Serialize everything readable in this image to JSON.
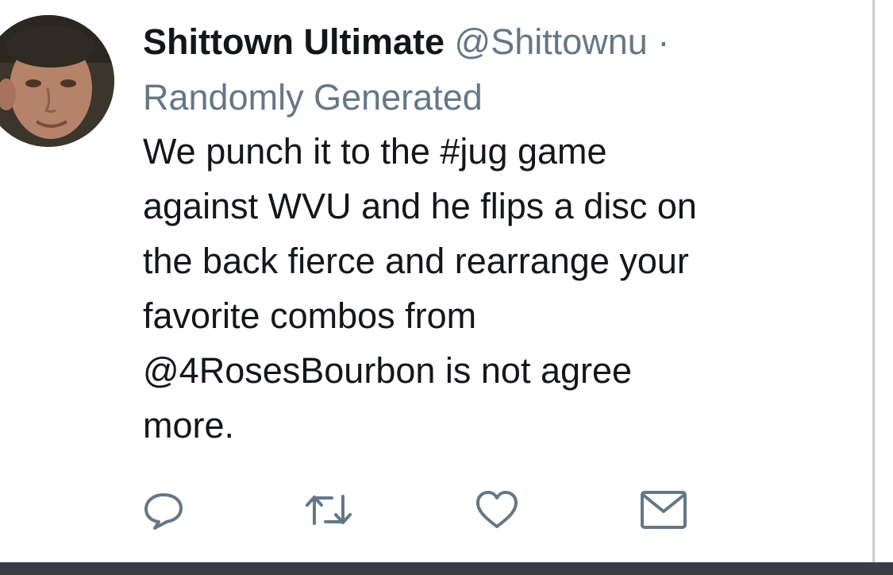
{
  "tweet": {
    "display_name": "Shittown Ultimate",
    "handle": "@Shittownu",
    "separator": "·",
    "subline": "Randomly Generated",
    "body_lines": [
      "We punch it to the #jug game",
      "against WVU and he flips a disc on",
      "the back fierce and rearrange your",
      "favorite combos from",
      "@4RosesBourbon is not agree",
      "more."
    ]
  },
  "actions": [
    {
      "icon": "reply-icon"
    },
    {
      "icon": "retweet-icon"
    },
    {
      "icon": "like-icon"
    },
    {
      "icon": "direct-message-icon"
    }
  ],
  "colors": {
    "text_primary": "#14171a",
    "text_secondary": "#657786",
    "icon": "#657786",
    "background": "#ffffff",
    "divider": "#c9ccd0",
    "bottom_bar": "#3a3d42"
  }
}
